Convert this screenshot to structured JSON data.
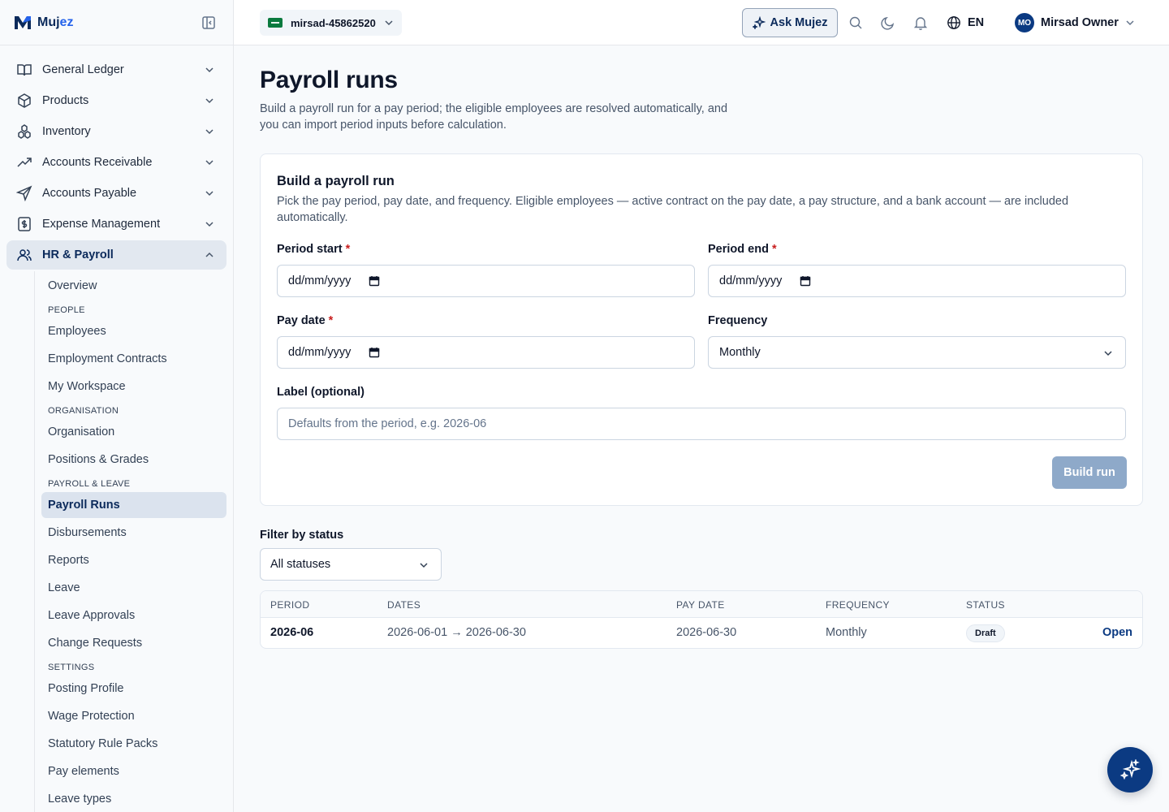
{
  "brand": {
    "name_main": "Muj",
    "name_accent": "ez"
  },
  "sidebar": {
    "items": [
      {
        "label": "General Ledger",
        "icon": "book-icon"
      },
      {
        "label": "Products",
        "icon": "box-icon"
      },
      {
        "label": "Inventory",
        "icon": "boxes-icon"
      },
      {
        "label": "Accounts Receivable",
        "icon": "trending-up-icon"
      },
      {
        "label": "Accounts Payable",
        "icon": "send-icon"
      },
      {
        "label": "Expense Management",
        "icon": "receipt-icon"
      },
      {
        "label": "HR & Payroll",
        "icon": "users-icon",
        "active": true
      }
    ],
    "hr_sub": {
      "overview": "Overview",
      "people_heading": "PEOPLE",
      "employees": "Employees",
      "contracts": "Employment Contracts",
      "workspace": "My Workspace",
      "org_heading": "ORGANISATION",
      "organisation": "Organisation",
      "positions": "Positions & Grades",
      "payroll_heading": "PAYROLL & LEAVE",
      "payroll_runs": "Payroll Runs",
      "disbursements": "Disbursements",
      "reports": "Reports",
      "leave": "Leave",
      "leave_approvals": "Leave Approvals",
      "change_requests": "Change Requests",
      "settings_heading": "SETTINGS",
      "posting_profile": "Posting Profile",
      "wage_protection": "Wage Protection",
      "statutory": "Statutory Rule Packs",
      "pay_elements": "Pay elements",
      "leave_types": "Leave types"
    }
  },
  "topbar": {
    "org": "mirsad-45862520",
    "ask": "Ask Mujez",
    "lang": "EN",
    "user_initials": "MO",
    "user_name": "Mirsad Owner"
  },
  "page": {
    "title": "Payroll runs",
    "description": "Build a payroll run for a pay period; the eligible employees are resolved automatically, and you can import period inputs before calculation."
  },
  "build_card": {
    "title": "Build a payroll run",
    "description": "Pick the pay period, pay date, and frequency. Eligible employees — active contract on the pay date, a pay structure, and a bank account — are included automatically.",
    "period_start_label": "Period start",
    "period_start_value": "dd/mm/yyyy",
    "period_end_label": "Period end",
    "period_end_value": "dd/mm/yyyy",
    "pay_date_label": "Pay date",
    "pay_date_value": "dd/mm/yyyy",
    "frequency_label": "Frequency",
    "frequency_value": "Monthly",
    "label_label": "Label (optional)",
    "label_placeholder": "Defaults from the period, e.g. 2026-06",
    "required_mark": "*",
    "build_button": "Build run"
  },
  "filter": {
    "label": "Filter by status",
    "value": "All statuses"
  },
  "runs_table": {
    "headers": {
      "period": "PERIOD",
      "dates": "DATES",
      "pay_date": "PAY DATE",
      "frequency": "FREQUENCY",
      "status": "STATUS"
    },
    "rows": [
      {
        "period": "2026-06",
        "dates": "2026-06-01 → 2026-06-30",
        "pay_date": "2026-06-30",
        "frequency": "Monthly",
        "status": "Draft",
        "action": "Open"
      }
    ]
  },
  "colors": {
    "primary": "#0b3a82",
    "brand": "#0b2a5b",
    "accent": "#2563eb",
    "required": "#c81e1e",
    "disabled_button": "#8ea9c9"
  }
}
